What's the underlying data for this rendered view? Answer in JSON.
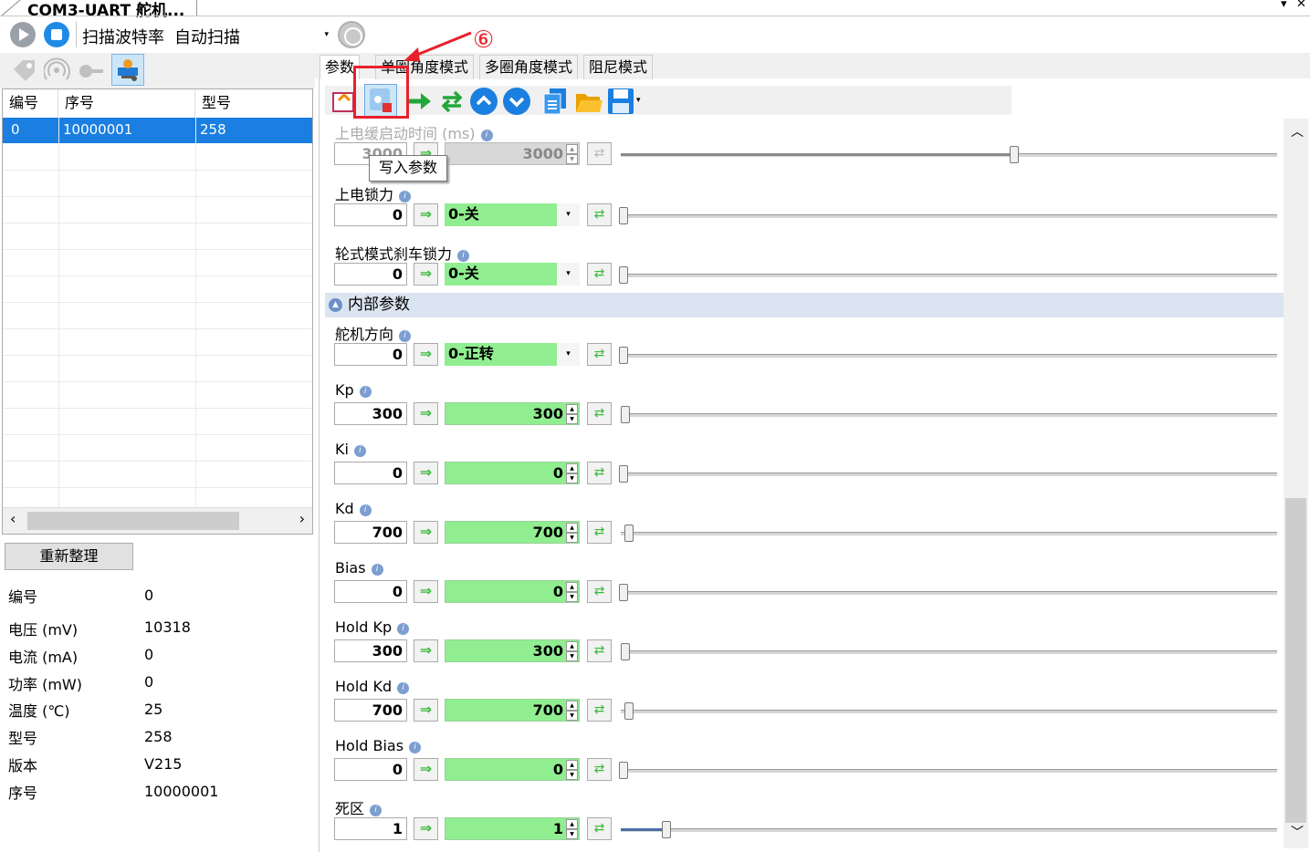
{
  "window": {
    "title": "COM3-UART 舵机...",
    "controls": [
      "▾",
      "✕"
    ]
  },
  "toolbar": {
    "baud_label": "扫描波特率",
    "baud_value": "自动扫描"
  },
  "table": {
    "headers": [
      "编号",
      "序号",
      "型号"
    ],
    "rows": [
      {
        "id": "0",
        "serial": "10000001",
        "model": "258"
      }
    ]
  },
  "left": {
    "reorg_button": "重新整理",
    "info": [
      {
        "label": "编号",
        "value": "0"
      },
      {
        "label": "电压 (mV)",
        "value": "10318"
      },
      {
        "label": "电流 (mA)",
        "value": "0"
      },
      {
        "label": "功率 (mW)",
        "value": "0"
      },
      {
        "label": "温度 (℃)",
        "value": "25"
      },
      {
        "label": "型号",
        "value": "258"
      },
      {
        "label": "版本",
        "value": "V215"
      },
      {
        "label": "序号",
        "value": "10000001"
      }
    ]
  },
  "tabs": [
    "参数",
    "单圈角度模式",
    "多圈角度模式",
    "阻尼模式"
  ],
  "tooltip": "写入参数",
  "annotation": "⑥",
  "section": {
    "title": "内部参数"
  },
  "params": [
    {
      "label": "上电缓启动时间 (ms)",
      "value": "3000",
      "target": "3000",
      "slider": 0.595
    },
    {
      "label": "上电锁力",
      "value": "0",
      "target": "0-关",
      "slider": 0
    },
    {
      "label": "轮式模式刹车锁力",
      "value": "0",
      "target": "0-关",
      "slider": 0
    },
    {
      "label": "舵机方向",
      "value": "0",
      "target": "0-正转",
      "slider": 0
    },
    {
      "label": "Kp",
      "value": "300",
      "target": "300",
      "slider": 0.003
    },
    {
      "label": "Ki",
      "value": "0",
      "target": "0",
      "slider": 0
    },
    {
      "label": "Kd",
      "value": "700",
      "target": "700",
      "slider": 0.008
    },
    {
      "label": "Bias",
      "value": "0",
      "target": "0",
      "slider": 0
    },
    {
      "label": "Hold Kp",
      "value": "300",
      "target": "300",
      "slider": 0.003
    },
    {
      "label": "Hold Kd",
      "value": "700",
      "target": "700",
      "slider": 0.008
    },
    {
      "label": "Hold Bias",
      "value": "0",
      "target": "0",
      "slider": 0
    },
    {
      "label": "死区",
      "value": "1",
      "target": "1",
      "slider": 0.066
    }
  ],
  "colors": {
    "accent": "#1a7fe0",
    "green_field": "#90ee90",
    "annotation_red": "#e8202a",
    "section_bg": "#dbe5f1"
  }
}
